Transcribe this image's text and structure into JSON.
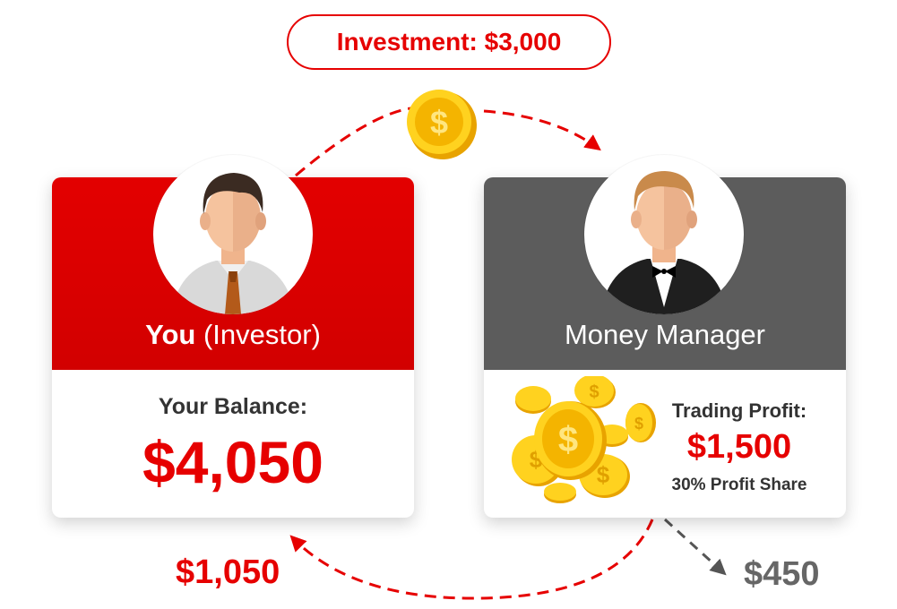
{
  "investment": {
    "label": "Investment: $3,000"
  },
  "investor": {
    "name": "You",
    "role": "(Investor)",
    "balance_label": "Your Balance:",
    "balance_value": "$4,050"
  },
  "manager": {
    "title": "Money Manager",
    "profit_label": "Trading Profit:",
    "profit_value": "$1,500",
    "profit_share": "30% Profit Share"
  },
  "flows": {
    "return_to_investor": "$1,050",
    "manager_fee": "$450"
  },
  "colors": {
    "accent_red": "#e60000",
    "manager_gray": "#5c5c5c",
    "coin_gold": "#f5b800",
    "fee_gray": "#666666"
  },
  "icons": [
    "coin-icon",
    "coin-pile-icon",
    "investor-avatar-icon",
    "manager-avatar-icon"
  ]
}
